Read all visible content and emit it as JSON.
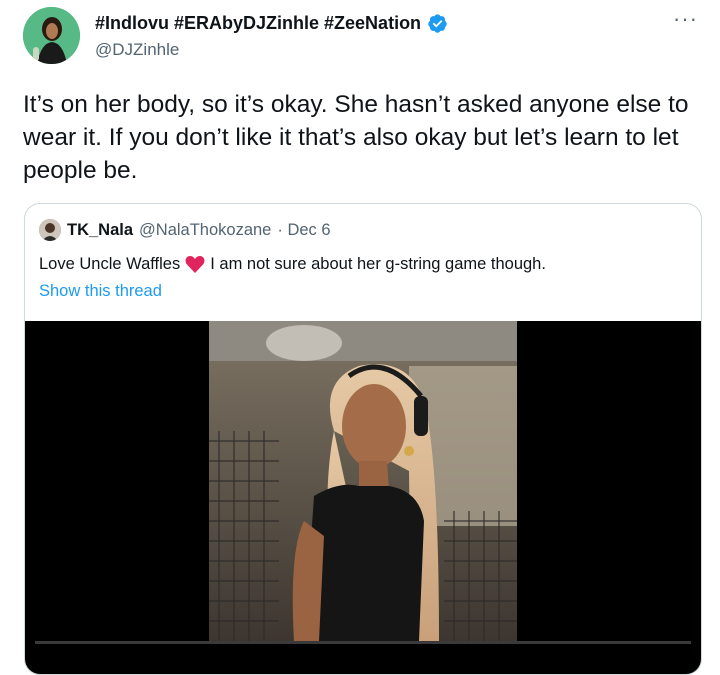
{
  "tweet": {
    "display_name": "#Indlovu #ERAbyDJZinhle #ZeeNation",
    "handle": "@DJZinhle",
    "more_icon": "more-horizontal-icon",
    "text": "It’s on her body, so it’s okay. She hasn’t asked anyone else to wear it. If you don’t like it that’s also okay but let’s learn to let people be."
  },
  "quoted_tweet": {
    "name": "TK_Nala",
    "handle": "@NalaThokozane",
    "date": "· Dec 6",
    "text_before": "Love Uncle Waffles",
    "text_after": "I am not sure about her g-string game though.",
    "show_thread": "Show this thread"
  },
  "colors": {
    "link": "#1d9bf0",
    "verified": "#1d9bf0",
    "heart": "#e0245e",
    "muted": "#536471",
    "border": "#cfd9de"
  }
}
